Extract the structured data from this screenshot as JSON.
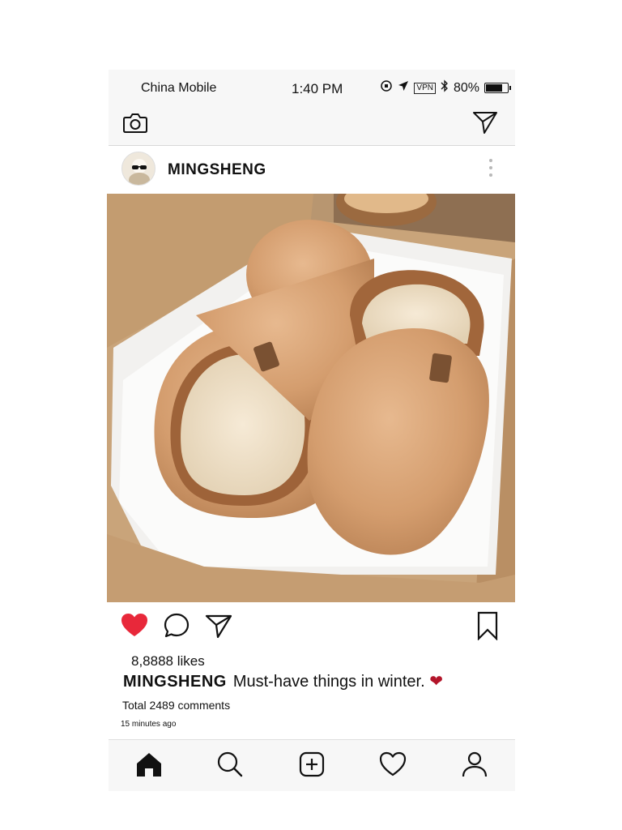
{
  "status_bar": {
    "carrier": "China Mobile",
    "time": "1:40 PM",
    "vpn": "VPN",
    "battery": "80%",
    "battery_level": 0.8
  },
  "top_nav": {
    "camera_icon": "camera-icon",
    "send_icon": "paper-plane-icon"
  },
  "post": {
    "username": "MINGSHENG",
    "more_icon": "vertical-dots-icon",
    "image_alt": "fluffy-brown-slippers-in-box",
    "likes": "8,8888 likes",
    "caption_user": "MINGSHENG",
    "caption_text": "Must-have things in winter.",
    "caption_heart": "❤",
    "comments": "Total 2489 comments",
    "time_ago": "15 minutes ago",
    "liked": true,
    "like_color": "#e8283a"
  },
  "bottom_nav": {
    "items": [
      "home-icon",
      "search-icon",
      "add-post-icon",
      "activity-heart-icon",
      "profile-icon"
    ],
    "active": "home-icon"
  }
}
